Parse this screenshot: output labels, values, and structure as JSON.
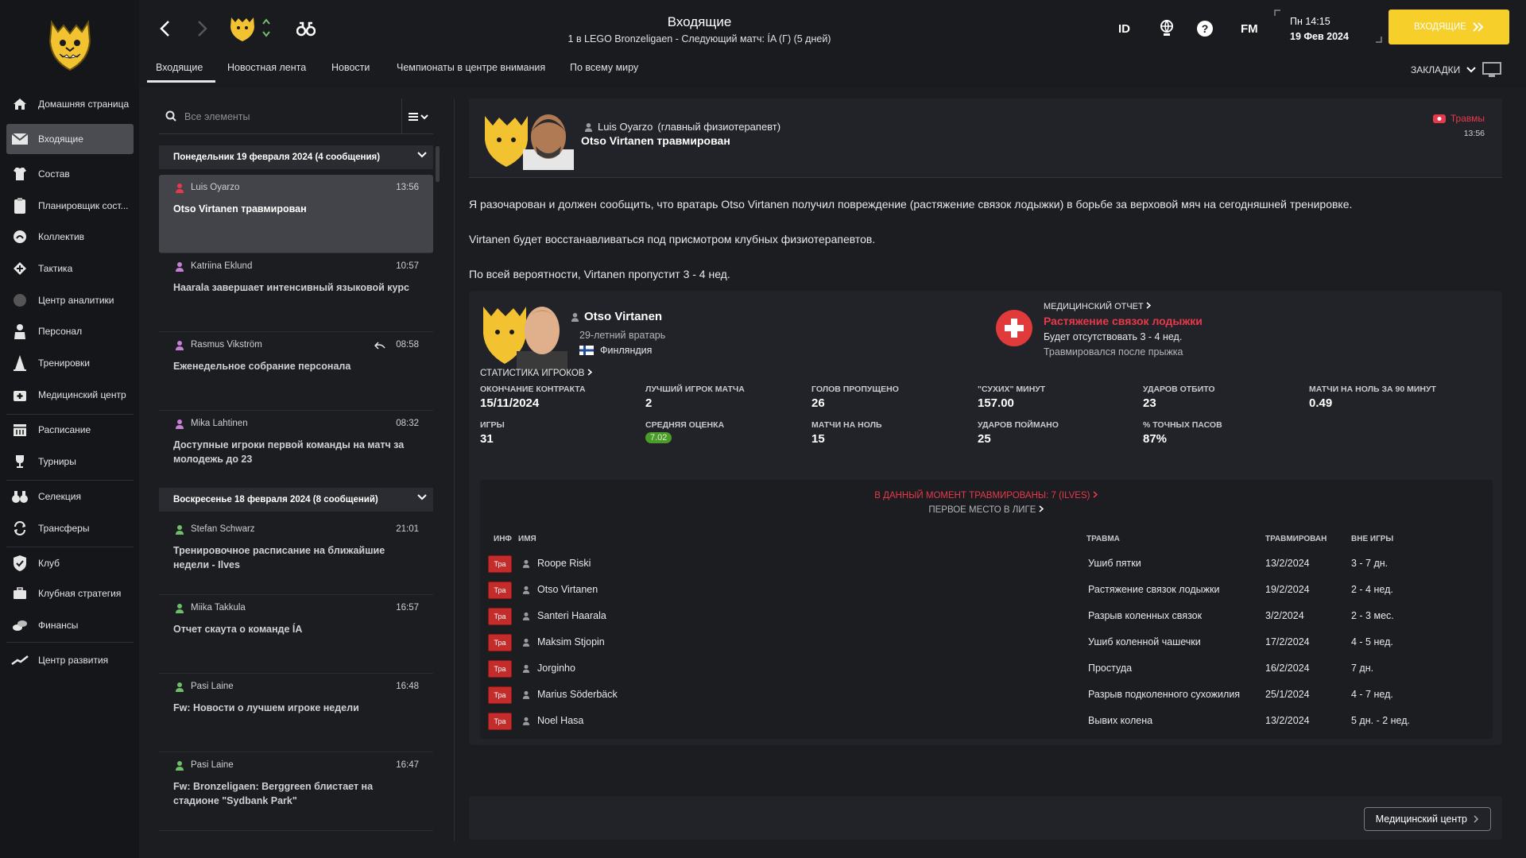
{
  "sidebar": {
    "items": [
      {
        "label": "Домашняя страница",
        "icon": "home-icon"
      },
      {
        "label": "Входящие",
        "icon": "inbox-icon"
      },
      {
        "label": "Состав",
        "icon": "squad-shirt-icon"
      },
      {
        "label": "Планировщик сост...",
        "icon": "squad-planner-icon"
      },
      {
        "label": "Коллектив",
        "icon": "dynamics-icon"
      },
      {
        "label": "Тактика",
        "icon": "tactics-icon"
      },
      {
        "label": "Центр аналитики",
        "icon": "analytics-icon"
      },
      {
        "label": "Персонал",
        "icon": "staff-icon"
      },
      {
        "label": "Тренировки",
        "icon": "training-cone-icon"
      },
      {
        "label": "Медицинский центр",
        "icon": "medical-kit-icon"
      },
      {
        "label": "Расписание",
        "icon": "calendar-icon"
      },
      {
        "label": "Турниры",
        "icon": "trophy-icon"
      },
      {
        "label": "Селекция",
        "icon": "binoculars-icon"
      },
      {
        "label": "Трансферы",
        "icon": "transfers-icon"
      },
      {
        "label": "Клуб",
        "icon": "club-shield-icon"
      },
      {
        "label": "Клубная стратегия",
        "icon": "briefcase-icon"
      },
      {
        "label": "Финансы",
        "icon": "finances-icon"
      },
      {
        "label": "Центр развития",
        "icon": "development-icon"
      }
    ]
  },
  "header": {
    "title": "Входящие",
    "subtitle": "1 в LEGO Bronzeligaen - Следующий матч: ÍA (Г) (5 дней)",
    "id_label": "ID",
    "fm_label": "FM",
    "time": "Пн 14:15",
    "date": "19 Фев 2024",
    "continue_label": "ВХОДЯЩИЕ",
    "bookmarks_label": "ЗАКЛАДКИ",
    "tabs": [
      "Входящие",
      "Новостная лента",
      "Новости",
      "Чемпионаты в центре внимания",
      "По всему миру"
    ]
  },
  "inbox": {
    "search_placeholder": "Все элементы",
    "groups": [
      {
        "header": "Понедельник 19 февраля 2024 (4 сообщения)"
      },
      {
        "header": "Воскресенье 18 февраля 2024 (8 сообщений)"
      }
    ],
    "messages": [
      {
        "sender": "Luis Oyarzo",
        "time": "13:56",
        "subject": "Otso Virtanen травмирован",
        "color": "#e8394a"
      },
      {
        "sender": "Katriina Eklund",
        "time": "10:57",
        "subject": "Haarala завершает интенсивный языковой курс",
        "color": "#c87fd8"
      },
      {
        "sender": "Rasmus Vikström",
        "time": "08:58",
        "subject": "Еженедельное собрание персонала",
        "color": "#c87fd8"
      },
      {
        "sender": "Mika Lahtinen",
        "time": "08:32",
        "subject": "Доступные игроки первой команды на матч за молодежь до 23",
        "color": "#c87fd8"
      },
      {
        "sender": "Stefan Schwarz",
        "time": "21:01",
        "subject": "Тренировочное расписание на ближайшие недели - Ilves",
        "color": "#6fbf6a"
      },
      {
        "sender": "Miika Takkula",
        "time": "16:57",
        "subject": "Отчет скаута о команде ÍA",
        "color": "#6fbf6a"
      },
      {
        "sender": "Pasi Laine",
        "time": "16:48",
        "subject": "Fw: Новости о лучшем игроке недели",
        "color": "#6fbf6a"
      },
      {
        "sender": "Pasi Laine",
        "time": "16:47",
        "subject": "Fw: Bronzeligaen: Berggreen блистает на стадионе \"Sydbank Park\"",
        "color": "#6fbf6a"
      }
    ]
  },
  "message": {
    "from": "Luis Oyarzo",
    "role": "(главный физиотерапевт)",
    "title": "Otso Virtanen травмирован",
    "tag": "Травмы",
    "tag_time": "13:56",
    "paragraphs": [
      "Я разочарован и должен сообщить, что вратарь Otso Virtanen получил повреждение (растяжение связок лодыжки) в борьбе за верховой мяч на сегодняшней тренировке.",
      "Virtanen будет восстанавливаться под присмотром клубных физиотерапевтов.",
      "По всей вероятности, Virtanen пропустит 3 - 4 нед."
    ]
  },
  "player": {
    "name": "Otso Virtanen",
    "age_position": "29-летний вратарь",
    "nationality": "Финляндия",
    "medical_label": "МЕДИЦИНСКИЙ ОТЧЕТ",
    "injury": "Растяжение связок лодыжки",
    "absence": "Будет отсутствовать 3 - 4 нед.",
    "cause": "Травмировался после прыжка",
    "stats_label": "СТАТИСТИКА ИГРОКОВ",
    "stats": [
      {
        "label": "ОКОНЧАНИЕ КОНТРАКТА",
        "value": "15/11/2024"
      },
      {
        "label": "ЛУЧШИЙ ИГРОК МАТЧА",
        "value": "2"
      },
      {
        "label": "ГОЛОВ ПРОПУЩЕНО",
        "value": "26"
      },
      {
        "label": "\"СУХИХ\" МИНУТ",
        "value": "157.00"
      },
      {
        "label": "УДАРОВ ОТБИТО",
        "value": "23"
      },
      {
        "label": "МАТЧИ НА НОЛЬ ЗА 90 МИНУТ",
        "value": "0.49"
      },
      {
        "label": "ИГРЫ",
        "value": "31"
      },
      {
        "label": "СРЕДНЯЯ ОЦЕНКА",
        "value": "7.02"
      },
      {
        "label": "МАТЧИ НА НОЛЬ",
        "value": "15"
      },
      {
        "label": "УДАРОВ ПОЙМАНО",
        "value": "25"
      },
      {
        "label": "% ТОЧНЫХ ПАСОВ",
        "value": "87%"
      }
    ]
  },
  "injuries": {
    "current": "В ДАННЫЙ МОМЕНТ ТРАВМИРОВАНЫ: 7 (ILVES)",
    "league": "ПЕРВОЕ МЕСТО В ЛИГЕ",
    "columns": [
      "ИНФ",
      "ИМЯ",
      "ТРАВМА",
      "ТРАВМИРОВАН",
      "ВНЕ ИГРЫ"
    ],
    "badge_label": "Тра",
    "rows": [
      {
        "name": "Roope Riski",
        "injury": "Ушиб пятки",
        "date": "13/2/2024",
        "out": "3 - 7 дн."
      },
      {
        "name": "Otso Virtanen",
        "injury": "Растяжение связок лодыжки",
        "date": "19/2/2024",
        "out": "2 - 4 нед."
      },
      {
        "name": "Santeri Haarala",
        "injury": "Разрыв коленных связок",
        "date": "3/2/2024",
        "out": "2 - 3 мес."
      },
      {
        "name": "Maksim Stjopin",
        "injury": "Ушиб коленной чашечки",
        "date": "17/2/2024",
        "out": "4 - 5 нед."
      },
      {
        "name": "Jorginho",
        "injury": "Простуда",
        "date": "16/2/2024",
        "out": "7 дн."
      },
      {
        "name": "Marius Söderbäck",
        "injury": "Разрыв подколенного сухожилия",
        "date": "25/1/2024",
        "out": "4 - 7 нед."
      },
      {
        "name": "Noel Hasa",
        "injury": "Вывих колена",
        "date": "13/2/2024",
        "out": "5 дн. - 2 нед."
      }
    ]
  },
  "footer": {
    "medical_center_label": "Медицинский центр"
  },
  "colors": {
    "accent": "#f6cf2b",
    "injury": "#e8394a",
    "rating": "#4a9b2a"
  }
}
